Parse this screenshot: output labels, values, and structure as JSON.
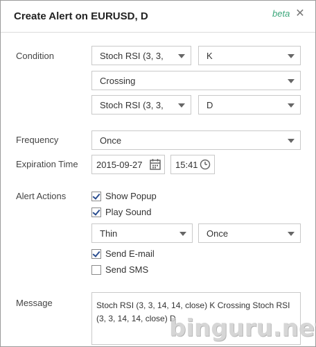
{
  "dialog": {
    "title": "Create Alert on EURUSD, D",
    "beta": "beta",
    "close_icon": "close-icon"
  },
  "condition": {
    "label": "Condition",
    "row1_left": "Stoch RSI (3, 3,",
    "row1_right": "K",
    "row2": "Crossing",
    "row3_left": "Stoch RSI (3, 3,",
    "row3_right": "D"
  },
  "frequency": {
    "label": "Frequency",
    "value": "Once"
  },
  "expiration": {
    "label": "Expiration Time",
    "date": "2015-09-27",
    "time": "15:41",
    "calendar_icon": "calendar-icon",
    "clock_icon": "clock-icon"
  },
  "alert_actions": {
    "label": "Alert Actions",
    "show_popup": {
      "label": "Show Popup",
      "checked": true
    },
    "play_sound": {
      "label": "Play Sound",
      "checked": true
    },
    "sound_type": "Thin",
    "sound_repeat": "Once",
    "send_email": {
      "label": "Send E-mail",
      "checked": true
    },
    "send_sms": {
      "label": "Send SMS",
      "checked": false
    }
  },
  "message": {
    "label": "Message",
    "text": "Stoch RSI (3, 3, 14, 14, close) K Crossing Stoch RSI (3, 3, 14, 14, close) D"
  },
  "watermark": "binguru.net",
  "colors": {
    "beta": "#3aa67a",
    "border": "#c9c9c9",
    "check": "#2a4d8f"
  }
}
